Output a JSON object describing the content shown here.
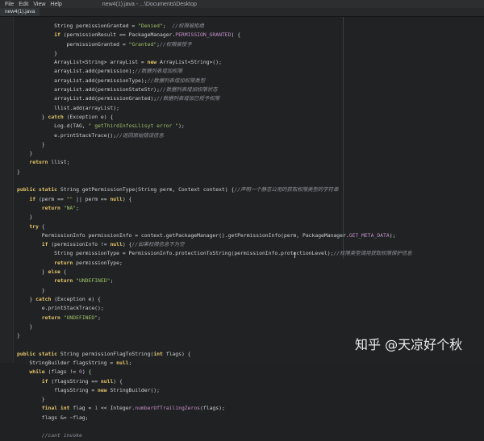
{
  "menubar": {
    "items": [
      "File",
      "Edit",
      "View",
      "Help"
    ],
    "title": "new4(1).java - ...\\Documents\\Desktop"
  },
  "tab": {
    "label": "new4(1).java"
  },
  "code_lines": [
    [
      [
        "",
        "            String permissionGranted = "
      ],
      [
        "str",
        "\"Denied\""
      ],
      [
        "",
        ";  "
      ],
      [
        "cm",
        "//权限被拒绝"
      ]
    ],
    [
      [
        "",
        "            "
      ],
      [
        "kw",
        "if"
      ],
      [
        "",
        " (permissionResult == PackageManager."
      ],
      [
        "cst",
        "PERMISSION_GRANTED"
      ],
      [
        "",
        ") {"
      ]
    ],
    [
      [
        "",
        "                permissionGranted = "
      ],
      [
        "str",
        "\"Granted\""
      ],
      [
        "",
        ";"
      ],
      [
        "cm",
        "//权限被授予"
      ]
    ],
    [
      [
        "",
        "            }"
      ]
    ],
    [
      [
        "",
        "            ArrayList<String> arrayList = "
      ],
      [
        "kw",
        "new"
      ],
      [
        "",
        " ArrayList<String>();"
      ]
    ],
    [
      [
        "",
        "            arrayList.add(permission);"
      ],
      [
        "cm",
        "//数据列表增加权限"
      ]
    ],
    [
      [
        "",
        "            arrayList.add(permissionType);"
      ],
      [
        "cm",
        "//数据列表增加权限类型"
      ]
    ],
    [
      [
        "",
        "            arrayList.add(permissionStateStr);"
      ],
      [
        "cm",
        "//数据列表增加权限状态"
      ]
    ],
    [
      [
        "",
        "            arrayList.add(permissionGranted);"
      ],
      [
        "cm",
        "//数据列表增加已授予权限"
      ]
    ],
    [
      [
        "",
        "            llist.add(arrayList);"
      ]
    ],
    [
      [
        "",
        "        } "
      ],
      [
        "kw",
        "catch"
      ],
      [
        "",
        " (Exception e) {"
      ]
    ],
    [
      [
        "",
        "            Log.d(TAG, "
      ],
      [
        "str",
        "\" getThirdInfosLlisyt error \""
      ],
      [
        "",
        ");"
      ]
    ],
    [
      [
        "",
        "            e.printStackTrace();"
      ],
      [
        "cm",
        "//返回原始错误信息"
      ]
    ],
    [
      [
        "",
        "        }"
      ]
    ],
    [
      [
        "",
        "    }"
      ]
    ],
    [
      [
        "",
        "    "
      ],
      [
        "kw",
        "return"
      ],
      [
        "",
        " llist;"
      ]
    ],
    [
      [
        "",
        "}"
      ]
    ],
    [
      [
        "",
        ""
      ]
    ],
    [
      [
        "kw",
        "public static"
      ],
      [
        "",
        " String getPermissionType(String perm, Context context) {"
      ],
      [
        "cm",
        "//声明一个静态公用的获取权限类型的字符串"
      ]
    ],
    [
      [
        "",
        "    "
      ],
      [
        "kw",
        "if"
      ],
      [
        "",
        " (perm == "
      ],
      [
        "str",
        "\"\""
      ],
      [
        "",
        " || perm == "
      ],
      [
        "kw",
        "null"
      ],
      [
        "",
        ") {"
      ]
    ],
    [
      [
        "",
        "        "
      ],
      [
        "kw",
        "return"
      ],
      [
        "",
        " "
      ],
      [
        "str",
        "\"NA\""
      ],
      [
        "",
        ";"
      ]
    ],
    [
      [
        "",
        "    }"
      ]
    ],
    [
      [
        "",
        "    "
      ],
      [
        "kw",
        "try"
      ],
      [
        "",
        " {"
      ]
    ],
    [
      [
        "",
        "        PermissionInfo permissionInfo = context.getPackageManager().getPermissionInfo(perm, PackageManager."
      ],
      [
        "cst",
        "GET_META_DATA"
      ],
      [
        "",
        ");"
      ]
    ],
    [
      [
        "",
        "        "
      ],
      [
        "kw",
        "if"
      ],
      [
        "",
        " (permissionInfo != "
      ],
      [
        "kw",
        "null"
      ],
      [
        "",
        ") {"
      ],
      [
        "cm",
        "//如果权限信息不为空"
      ]
    ],
    [
      [
        "",
        "            String permissionType = PermissionInfo.protectionToString(permissionInfo.protectionLevel);"
      ],
      [
        "cm",
        "//权限类型调用获取权限保护信息"
      ]
    ],
    [
      [
        "",
        "            "
      ],
      [
        "kw",
        "return"
      ],
      [
        "",
        " permissionType;"
      ]
    ],
    [
      [
        "",
        "        } "
      ],
      [
        "kw",
        "else"
      ],
      [
        "",
        " {"
      ]
    ],
    [
      [
        "",
        "            "
      ],
      [
        "kw",
        "return"
      ],
      [
        "",
        " "
      ],
      [
        "str",
        "\"UNDEFINED\""
      ],
      [
        "",
        ";"
      ]
    ],
    [
      [
        "",
        "        }"
      ]
    ],
    [
      [
        "",
        "    } "
      ],
      [
        "kw",
        "catch"
      ],
      [
        "",
        " (Exception e) {"
      ]
    ],
    [
      [
        "",
        "        e.printStackTrace();"
      ]
    ],
    [
      [
        "",
        "        "
      ],
      [
        "kw",
        "return"
      ],
      [
        "",
        " "
      ],
      [
        "str",
        "\"UNDEFINED\""
      ],
      [
        "",
        ";"
      ]
    ],
    [
      [
        "",
        "    }"
      ]
    ],
    [
      [
        "",
        "}"
      ]
    ],
    [
      [
        "",
        ""
      ]
    ],
    [
      [
        "kw",
        "public static"
      ],
      [
        "",
        " String permissionFlagToString("
      ],
      [
        "kw",
        "int"
      ],
      [
        "",
        " flags) {"
      ]
    ],
    [
      [
        "",
        "    StringBuilder flagsString = "
      ],
      [
        "kw",
        "null"
      ],
      [
        "",
        ";"
      ]
    ],
    [
      [
        "",
        "    "
      ],
      [
        "kw",
        "while"
      ],
      [
        "",
        " (flags != "
      ],
      [
        "cst",
        "0"
      ],
      [
        "",
        ") {"
      ]
    ],
    [
      [
        "",
        "        "
      ],
      [
        "kw",
        "if"
      ],
      [
        "",
        " (flagsString == "
      ],
      [
        "kw",
        "null"
      ],
      [
        "",
        ") {"
      ]
    ],
    [
      [
        "",
        "            flagsString = "
      ],
      [
        "kw",
        "new"
      ],
      [
        "",
        " StringBuilder();"
      ]
    ],
    [
      [
        "",
        "        }"
      ]
    ],
    [
      [
        "",
        "        "
      ],
      [
        "kw",
        "final int"
      ],
      [
        "",
        " flag = "
      ],
      [
        "cst",
        "1"
      ],
      [
        "",
        " << Integer."
      ],
      [
        "cst",
        "numberOfTrailingZeros"
      ],
      [
        "",
        "(flags);"
      ]
    ],
    [
      [
        "",
        "        flags &= ~flag;"
      ]
    ],
    [
      [
        "",
        ""
      ]
    ],
    [
      [
        "",
        "        "
      ],
      [
        "cm",
        "//cant invoke"
      ]
    ]
  ],
  "watermark": {
    "text": "知乎 @天凉好个秋"
  }
}
